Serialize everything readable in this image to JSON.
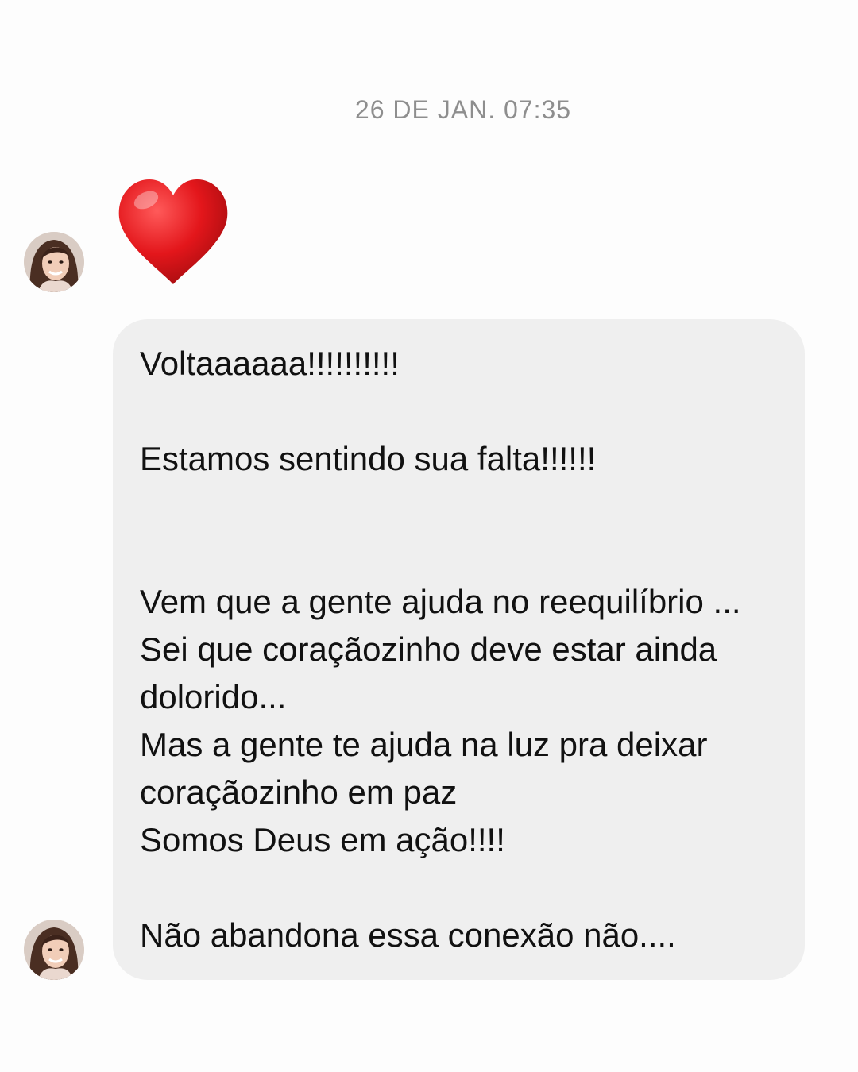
{
  "thread": {
    "timestamp": "26 DE JAN. 07:35"
  },
  "messages": [
    {
      "type": "emoji",
      "emoji": "red-heart",
      "color": "#e3161b"
    },
    {
      "type": "text",
      "lines": [
        "Voltaaaaaa!!!!!!!!!!",
        "Estamos sentindo sua falta!!!!!!",
        "Vem que a gente ajuda no reequilíbrio ...",
        "Sei que coraçãozinho deve estar ainda",
        "dolorido...",
        "Mas a gente te ajuda na luz pra deixar",
        "coraçãozinho em paz",
        "Somos Deus em ação!!!!",
        "Não abandona essa conexão não...."
      ]
    }
  ],
  "colors": {
    "background": "#fdfdfd",
    "bubble": "#efefef",
    "timestamp": "#8e8e8e",
    "text": "#111111"
  }
}
